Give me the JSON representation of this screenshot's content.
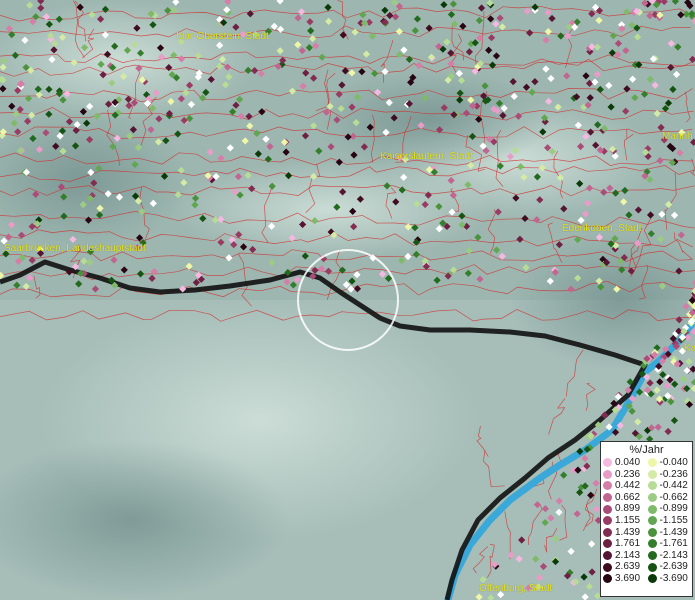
{
  "map": {
    "labels": [
      {
        "text": "Idar-Oberstein, Stadt",
        "id": "idar-oberstein"
      },
      {
        "text": "Kaiserslautern, Stadt",
        "id": "kaiserslautern"
      },
      {
        "text": "Mannh",
        "id": "mannheim"
      },
      {
        "text": "Saarbrücken, Landeshauptstadt",
        "id": "saarbruecken"
      },
      {
        "text": "Edenkoben, Stadt",
        "id": "edenkoben"
      },
      {
        "text": "Ka",
        "id": "karlsruhe"
      },
      {
        "text": "Offenburg, Stadt",
        "id": "offenburg"
      }
    ],
    "colors": {
      "terrain_light": "#b8cfc8",
      "terrain_dark": "#7e9c98",
      "boundary": "#d22a2a",
      "border": "#111111",
      "river": "#3aa8d8",
      "label": "#e6e31a",
      "highlight_ring": "#ffffff"
    }
  },
  "legend": {
    "title": "%/Jahr",
    "rows": [
      {
        "pos": "0.040",
        "neg": "-0.040",
        "pos_color": "#f5b8e0",
        "neg_color": "#eef7a8"
      },
      {
        "pos": "0.236",
        "neg": "-0.236",
        "pos_color": "#ea9cc9",
        "neg_color": "#d3eba4"
      },
      {
        "pos": "0.442",
        "neg": "-0.442",
        "pos_color": "#d47ea8",
        "neg_color": "#b6dc96"
      },
      {
        "pos": "0.662",
        "neg": "-0.662",
        "pos_color": "#c06690",
        "neg_color": "#9ccc84"
      },
      {
        "pos": "0.899",
        "neg": "-0.899",
        "pos_color": "#aa4c78",
        "neg_color": "#7fba6a"
      },
      {
        "pos": "1.155",
        "neg": "-1.155",
        "pos_color": "#983c64",
        "neg_color": "#62a651"
      },
      {
        "pos": "1.439",
        "neg": "-1.439",
        "pos_color": "#832c52",
        "neg_color": "#4a923c"
      },
      {
        "pos": "1.761",
        "neg": "-1.761",
        "pos_color": "#6e2042",
        "neg_color": "#357e2c"
      },
      {
        "pos": "2.143",
        "neg": "-2.143",
        "pos_color": "#561532",
        "neg_color": "#216a1e"
      },
      {
        "pos": "2.639",
        "neg": "-2.639",
        "pos_color": "#3f0c22",
        "neg_color": "#155412"
      },
      {
        "pos": "3.690",
        "neg": "-3.690",
        "pos_color": "#280512",
        "neg_color": "#0a3a08"
      }
    ]
  }
}
